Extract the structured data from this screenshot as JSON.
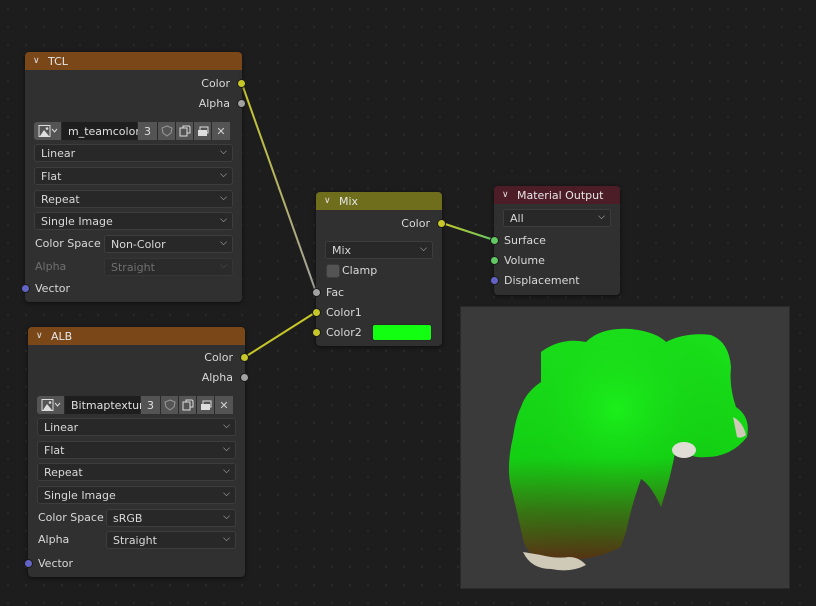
{
  "editor": "Shader Editor",
  "nodes": {
    "tcl": {
      "title": "TCL",
      "header_color": "#7a4718",
      "outputs": [
        {
          "label": "Color",
          "socket": "yellow"
        },
        {
          "label": "Alpha",
          "socket": "gray"
        }
      ],
      "image": {
        "name": "m_teamcolor...",
        "users": "3",
        "icons": [
          "image-type-icon",
          "fake-user-shield-icon",
          "duplicate-icon",
          "open-image-icon",
          "unlink-icon"
        ]
      },
      "interpolation": "Linear",
      "projection": "Flat",
      "extension": "Repeat",
      "source": "Single Image",
      "color_space_label": "Color Space",
      "color_space": "Non-Color",
      "alpha_label": "Alpha",
      "alpha": "Straight",
      "alpha_disabled": true,
      "inputs": [
        {
          "label": "Vector",
          "socket": "purple"
        }
      ]
    },
    "alb": {
      "title": "ALB",
      "header_color": "#7a4718",
      "outputs": [
        {
          "label": "Color",
          "socket": "yellow"
        },
        {
          "label": "Alpha",
          "socket": "gray"
        }
      ],
      "image": {
        "name": "Bitmaptextur...",
        "users": "3",
        "icons": [
          "image-type-icon",
          "fake-user-shield-icon",
          "duplicate-icon",
          "open-image-icon",
          "unlink-icon"
        ]
      },
      "interpolation": "Linear",
      "projection": "Flat",
      "extension": "Repeat",
      "source": "Single Image",
      "color_space_label": "Color Space",
      "color_space": "sRGB",
      "alpha_label": "Alpha",
      "alpha": "Straight",
      "alpha_disabled": false,
      "inputs": [
        {
          "label": "Vector",
          "socket": "purple"
        }
      ]
    },
    "mix": {
      "title": "Mix",
      "header_color": "#6e6e1d",
      "output": "Color",
      "blend_type": "Mix",
      "clamp_label": "Clamp",
      "clamp": false,
      "inputs": [
        {
          "label": "Fac",
          "socket": "gray"
        },
        {
          "label": "Color1",
          "socket": "yellow"
        },
        {
          "label": "Color2",
          "socket": "yellow"
        }
      ],
      "color2_value": "#12ff12"
    },
    "material_output": {
      "title": "Material Output",
      "header_color": "#4d1d27",
      "target": "All",
      "inputs": [
        {
          "label": "Surface",
          "socket": "green"
        },
        {
          "label": "Volume",
          "socket": "green"
        },
        {
          "label": "Displacement",
          "socket": "purple"
        }
      ]
    }
  },
  "links": [
    {
      "from": "TCL.Color",
      "to": "Mix.Fac"
    },
    {
      "from": "ALB.Color",
      "to": "Mix.Color1"
    },
    {
      "from": "Mix.Color",
      "to": "Material Output.Surface"
    }
  ],
  "preview": {
    "description": "Material preview render of green-tinted mesh"
  },
  "colors": {
    "socket_yellow": "#c7c729",
    "socket_gray": "#a1a1a1",
    "socket_green": "#63c763",
    "socket_purple": "#6363c7"
  }
}
